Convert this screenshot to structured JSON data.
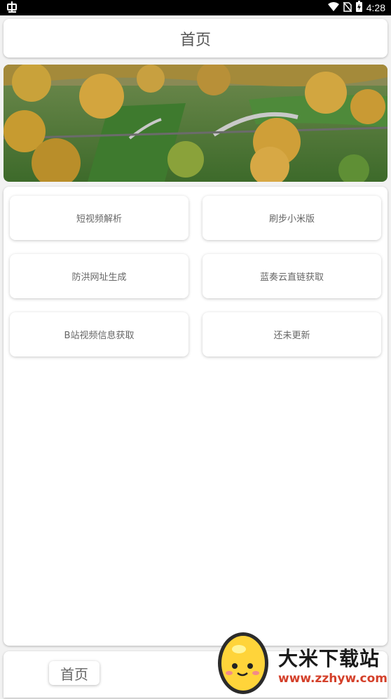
{
  "status_bar": {
    "time": "4:28",
    "app_icon": "bug-icon",
    "icons": [
      "wifi-icon",
      "no-sim-icon",
      "battery-charging-icon"
    ]
  },
  "header": {
    "title": "首页"
  },
  "banner": {
    "image": "aerial-landscape-wildlife-overpass"
  },
  "tools": [
    {
      "label": "短视频解析"
    },
    {
      "label": "刷步小米版"
    },
    {
      "label": "防洪网址生成"
    },
    {
      "label": "蓝奏云直链获取"
    },
    {
      "label": "B站视频信息获取"
    },
    {
      "label": "还未更新"
    }
  ],
  "bottom_nav": {
    "home_label": "首页"
  },
  "watermark": {
    "name": "大米下载站",
    "url": "www.zzhyw.com"
  },
  "colors": {
    "background": "#f2f2f2",
    "card": "#ffffff",
    "text": "#666666",
    "watermark_url": "#d4402a"
  }
}
